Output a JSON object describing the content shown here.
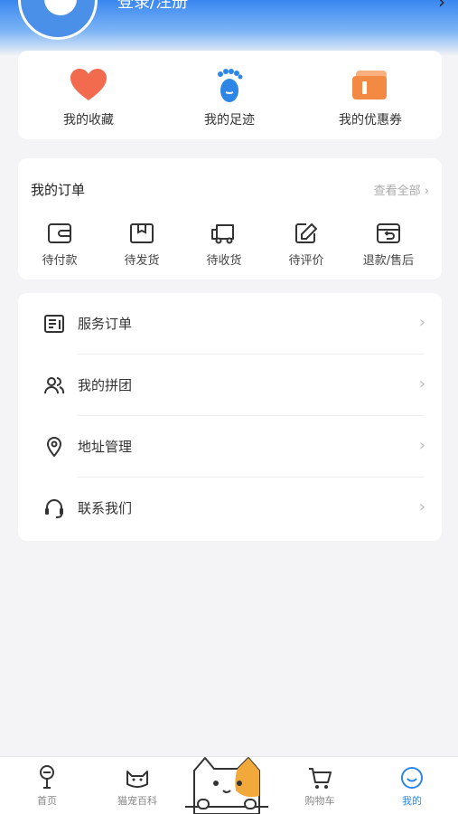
{
  "header": {
    "login_label": "登录/注册"
  },
  "quick": [
    {
      "label": "我的收藏",
      "icon": "heart-icon"
    },
    {
      "label": "我的足迹",
      "icon": "footprint-icon"
    },
    {
      "label": "我的优惠券",
      "icon": "coupon-icon"
    }
  ],
  "orders": {
    "title": "我的订单",
    "view_all": "查看全部 ›",
    "items": [
      {
        "label": "待付款",
        "icon": "wallet-icon"
      },
      {
        "label": "待发货",
        "icon": "box-icon"
      },
      {
        "label": "待收货",
        "icon": "truck-icon"
      },
      {
        "label": "待评价",
        "icon": "edit-icon"
      },
      {
        "label": "退款/售后",
        "icon": "refund-icon"
      }
    ]
  },
  "menu": [
    {
      "label": "服务订单",
      "icon": "document-icon"
    },
    {
      "label": "我的拼团",
      "icon": "group-icon"
    },
    {
      "label": "地址管理",
      "icon": "location-icon"
    },
    {
      "label": "联系我们",
      "icon": "headset-icon"
    }
  ],
  "tabbar": [
    {
      "label": "首页",
      "icon": "home-icon"
    },
    {
      "label": "猫宠百科",
      "icon": "cat-icon"
    },
    {
      "label": "购物车",
      "icon": "cart-icon"
    },
    {
      "label": "我的",
      "icon": "smile-icon"
    }
  ],
  "colors": {
    "accent": "#2d86e6",
    "heart": "#f26b4f",
    "coupon": "#f38a44"
  }
}
